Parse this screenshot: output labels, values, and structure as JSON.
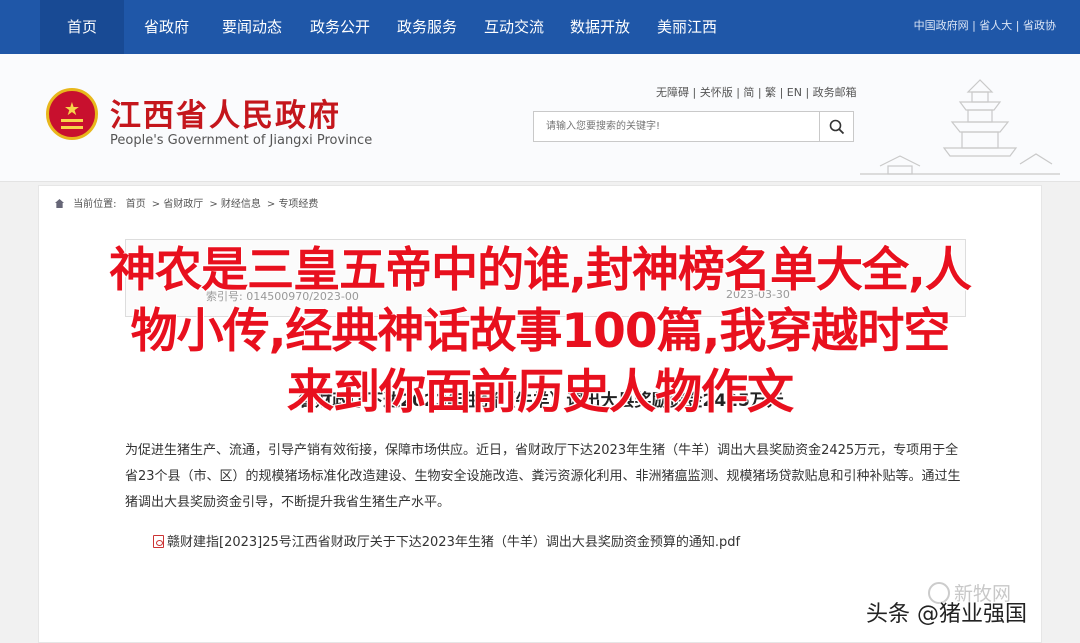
{
  "topnav": {
    "items": [
      "首页",
      "省政府",
      "要闻动态",
      "政务公开",
      "政务服务",
      "互动交流",
      "数据开放",
      "美丽江西"
    ],
    "links": "中国政府网 | 省人大 | 省政协"
  },
  "header": {
    "title_cn": "江西省人民政府",
    "title_en": "People's Government of Jiangxi Province",
    "util_links": "无障碍 | 关怀版 | 简 | 繁 | EN | 政务邮箱",
    "search_placeholder": "请输入您要搜索的关键字!"
  },
  "breadcrumb": {
    "label": "当前位置:",
    "items": [
      "首页",
      "省财政厅",
      "财经信息",
      "专项经费"
    ]
  },
  "info": {
    "meta": "索引号: 014500970/2023-00",
    "date": "2023-03-30"
  },
  "article": {
    "title": "省财政厅下达2023年生猪（牛羊）调出大县奖励资金2425万元",
    "body": "为促进生猪生产、流通，引导产销有效衔接，保障市场供应。近日，省财政厅下达2023年生猪（牛羊）调出大县奖励资金2425万元，专项用于全省23个县（市、区）的规模猪场标准化改造建设、生物安全设施改造、粪污资源化利用、非洲猪瘟监测、规模猪场贷款贴息和引种补贴等。通过生猪调出大县奖励资金引导，不断提升我省生猪生产水平。",
    "attachment": "赣财建指[2023]25号江西省财政厅关于下达2023年生猪（牛羊）调出大县奖励资金预算的通知.pdf"
  },
  "overlay": {
    "lines": [
      "神农是三皇五帝中的谁,封神榜名单大全,人",
      "物小传,经典神话故事100篇,我穿越时空",
      "来到你面前历史人物作文"
    ]
  },
  "watermarks": {
    "xinmuwang": "新牧网",
    "toutiao": "头条 @猪业强国"
  }
}
